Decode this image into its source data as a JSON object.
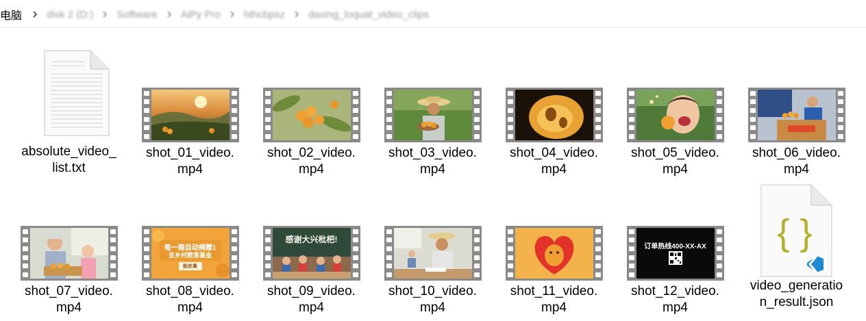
{
  "address_bar": {
    "root": "电脑",
    "crumbs": [
      "disk 2 (D:)",
      "Software",
      "AiPy Pro",
      "hthcbpsz",
      "daxing_loquat_video_clips"
    ]
  },
  "files": [
    {
      "name": "absolute_video_list.txt",
      "line1": "absolute_video_",
      "line2": "list.txt",
      "icon": "text-file-icon"
    },
    {
      "name": "shot_01_video.mp4",
      "line1": "shot_01_video.",
      "line2": "mp4",
      "scene": "sunset-mountain-loquat-orchard"
    },
    {
      "name": "shot_02_video.mp4",
      "line1": "shot_02_video.",
      "line2": "mp4",
      "scene": "loquat-cluster-on-branch"
    },
    {
      "name": "shot_03_video.mp4",
      "line1": "shot_03_video.",
      "line2": "mp4",
      "scene": "farmer-holding-basket"
    },
    {
      "name": "shot_04_video.mp4",
      "line1": "shot_04_video.",
      "line2": "mp4",
      "scene": "loquat-closeup"
    },
    {
      "name": "shot_05_video.mp4",
      "line1": "shot_05_video.",
      "line2": "mp4",
      "scene": "child-eating-loquat"
    },
    {
      "name": "shot_06_video.mp4",
      "line1": "shot_06_video.",
      "line2": "mp4",
      "scene": "courier-with-box"
    },
    {
      "name": "shot_07_video.mp4",
      "line1": "shot_07_video.",
      "line2": "mp4",
      "scene": "grandparent-and-child"
    },
    {
      "name": "shot_08_video.mp4",
      "line1": "shot_08_video.",
      "line2": "mp4",
      "scene": "donation-card",
      "overlay": [
        "每一箱自动捐赠1",
        "支乡村教育基金"
      ],
      "overlay_small": "助农果"
    },
    {
      "name": "shot_09_video.mp4",
      "line1": "shot_09_video.",
      "line2": "mp4",
      "scene": "classroom-chalkboard",
      "overlay": [
        "感谢大兴枇杷!"
      ]
    },
    {
      "name": "shot_10_video.mp4",
      "line1": "shot_10_video.",
      "line2": "mp4",
      "scene": "farmer-in-classroom"
    },
    {
      "name": "shot_11_video.mp4",
      "line1": "shot_11_video.",
      "line2": "mp4",
      "scene": "heart-loquat"
    },
    {
      "name": "shot_12_video.mp4",
      "line1": "shot_12_video.",
      "line2": "mp4",
      "scene": "hotline-qr",
      "overlay": [
        "订单热线400-XX-AX"
      ]
    },
    {
      "name": "video_generation_result.json",
      "line1": "video_generatio",
      "line2": "n_result.json",
      "icon": "json-file-icon"
    }
  ],
  "colors": {
    "film": "#8a8a8a",
    "json_brace": "#b5b02a",
    "vscode_blue": "#1f8ad2",
    "loquat": "#f0a030"
  }
}
